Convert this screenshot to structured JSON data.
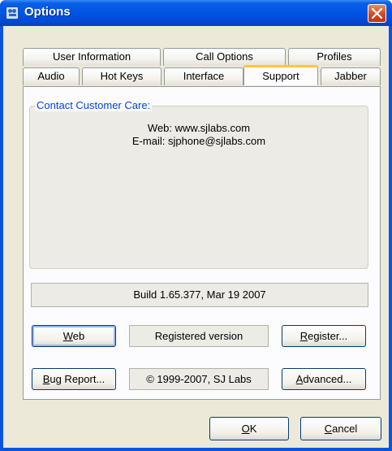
{
  "window": {
    "title": "Options"
  },
  "tabs_top_row": [
    "User Information",
    "Call Options",
    "Profiles"
  ],
  "tabs_bottom_row": [
    "Audio",
    "Hot Keys",
    "Interface",
    "Support",
    "Jabber"
  ],
  "active_tab": "Support",
  "contact": {
    "legend": "Contact Customer Care:",
    "web_line": "Web: www.sjlabs.com",
    "email_line": "E-mail: sjphone@sjlabs.com"
  },
  "build_info": "Build 1.65.377, Mar 19 2007",
  "buttons": {
    "web_first": "W",
    "web_rest": "eb",
    "register_first": "R",
    "register_rest": "egister...",
    "bug_first": "B",
    "bug_rest": "ug Report...",
    "advanced_first": "A",
    "advanced_rest": "dvanced...",
    "ok_first": "O",
    "ok_rest": "K",
    "cancel_first": "C",
    "cancel_rest": "ancel"
  },
  "registration_status": "Registered version",
  "copyright": "© 1999-2007, SJ Labs",
  "colors": {
    "titlebar": "#0054e3",
    "dialog_face": "#ece9d8",
    "active_tab_accent": "#ffc83c",
    "group_legend": "#0046d5",
    "close_button": "#d6471f"
  },
  "icons": [
    "app-icon",
    "close-icon"
  ]
}
